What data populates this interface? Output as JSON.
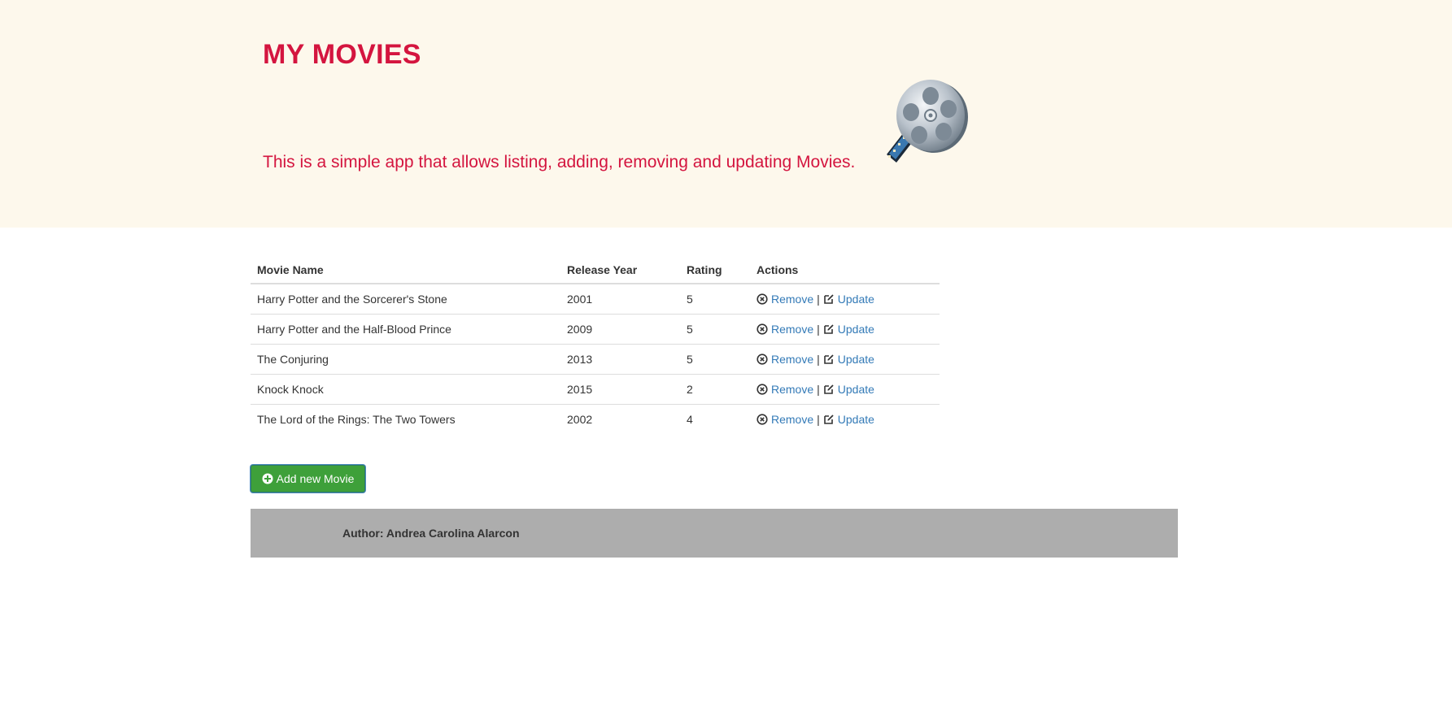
{
  "header": {
    "title": "MY MOVIES",
    "description": "This is a simple app that allows listing, adding, removing and updating Movies.",
    "logo_icon": "film-reel-icon"
  },
  "table": {
    "columns": [
      "Movie Name",
      "Release Year",
      "Rating",
      "Actions"
    ],
    "rows": [
      {
        "name": "Harry Potter and the Sorcerer's Stone",
        "year": "2001",
        "rating": "5"
      },
      {
        "name": "Harry Potter and the Half-Blood Prince",
        "year": "2009",
        "rating": "5"
      },
      {
        "name": "The Conjuring",
        "year": "2013",
        "rating": "5"
      },
      {
        "name": "Knock Knock",
        "year": "2015",
        "rating": "2"
      },
      {
        "name": "The Lord of the Rings: The Two Towers",
        "year": "2002",
        "rating": "4"
      }
    ],
    "actions": {
      "remove_label": "Remove",
      "update_label": "Update",
      "separator": "|",
      "remove_icon": "circle-x-icon",
      "update_icon": "edit-icon"
    }
  },
  "add_button": {
    "label": "Add new Movie",
    "icon": "plus-circle-icon"
  },
  "footer": {
    "text": "Author: Andrea Carolina Alarcon"
  },
  "colors": {
    "accent": "#d4153f",
    "hero_background": "#fdf8ec",
    "link": "#337ab7",
    "button": "#3ea03a",
    "footer_background": "#adadad"
  }
}
